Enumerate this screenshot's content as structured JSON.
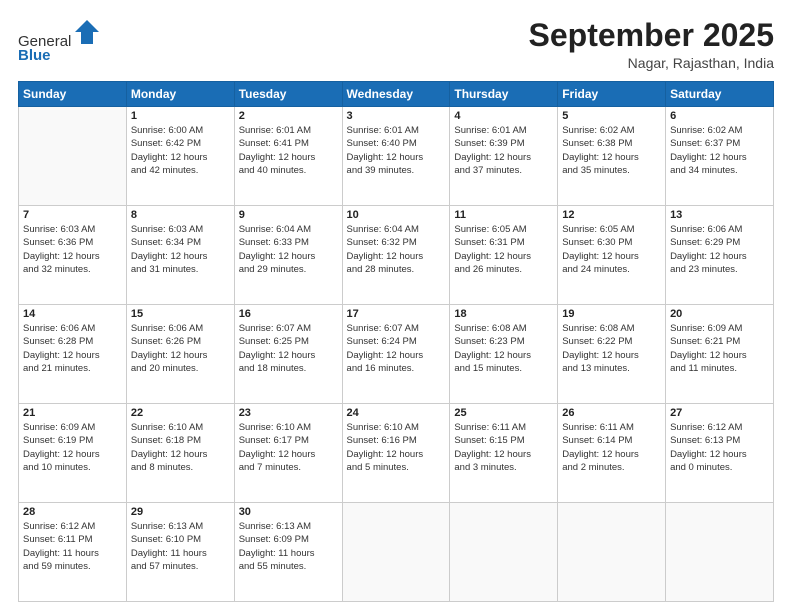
{
  "header": {
    "logo_line1": "General",
    "logo_line2": "Blue",
    "month": "September 2025",
    "location": "Nagar, Rajasthan, India"
  },
  "days_of_week": [
    "Sunday",
    "Monday",
    "Tuesday",
    "Wednesday",
    "Thursday",
    "Friday",
    "Saturday"
  ],
  "weeks": [
    [
      {
        "day": "",
        "info": ""
      },
      {
        "day": "1",
        "info": "Sunrise: 6:00 AM\nSunset: 6:42 PM\nDaylight: 12 hours\nand 42 minutes."
      },
      {
        "day": "2",
        "info": "Sunrise: 6:01 AM\nSunset: 6:41 PM\nDaylight: 12 hours\nand 40 minutes."
      },
      {
        "day": "3",
        "info": "Sunrise: 6:01 AM\nSunset: 6:40 PM\nDaylight: 12 hours\nand 39 minutes."
      },
      {
        "day": "4",
        "info": "Sunrise: 6:01 AM\nSunset: 6:39 PM\nDaylight: 12 hours\nand 37 minutes."
      },
      {
        "day": "5",
        "info": "Sunrise: 6:02 AM\nSunset: 6:38 PM\nDaylight: 12 hours\nand 35 minutes."
      },
      {
        "day": "6",
        "info": "Sunrise: 6:02 AM\nSunset: 6:37 PM\nDaylight: 12 hours\nand 34 minutes."
      }
    ],
    [
      {
        "day": "7",
        "info": "Sunrise: 6:03 AM\nSunset: 6:36 PM\nDaylight: 12 hours\nand 32 minutes."
      },
      {
        "day": "8",
        "info": "Sunrise: 6:03 AM\nSunset: 6:34 PM\nDaylight: 12 hours\nand 31 minutes."
      },
      {
        "day": "9",
        "info": "Sunrise: 6:04 AM\nSunset: 6:33 PM\nDaylight: 12 hours\nand 29 minutes."
      },
      {
        "day": "10",
        "info": "Sunrise: 6:04 AM\nSunset: 6:32 PM\nDaylight: 12 hours\nand 28 minutes."
      },
      {
        "day": "11",
        "info": "Sunrise: 6:05 AM\nSunset: 6:31 PM\nDaylight: 12 hours\nand 26 minutes."
      },
      {
        "day": "12",
        "info": "Sunrise: 6:05 AM\nSunset: 6:30 PM\nDaylight: 12 hours\nand 24 minutes."
      },
      {
        "day": "13",
        "info": "Sunrise: 6:06 AM\nSunset: 6:29 PM\nDaylight: 12 hours\nand 23 minutes."
      }
    ],
    [
      {
        "day": "14",
        "info": "Sunrise: 6:06 AM\nSunset: 6:28 PM\nDaylight: 12 hours\nand 21 minutes."
      },
      {
        "day": "15",
        "info": "Sunrise: 6:06 AM\nSunset: 6:26 PM\nDaylight: 12 hours\nand 20 minutes."
      },
      {
        "day": "16",
        "info": "Sunrise: 6:07 AM\nSunset: 6:25 PM\nDaylight: 12 hours\nand 18 minutes."
      },
      {
        "day": "17",
        "info": "Sunrise: 6:07 AM\nSunset: 6:24 PM\nDaylight: 12 hours\nand 16 minutes."
      },
      {
        "day": "18",
        "info": "Sunrise: 6:08 AM\nSunset: 6:23 PM\nDaylight: 12 hours\nand 15 minutes."
      },
      {
        "day": "19",
        "info": "Sunrise: 6:08 AM\nSunset: 6:22 PM\nDaylight: 12 hours\nand 13 minutes."
      },
      {
        "day": "20",
        "info": "Sunrise: 6:09 AM\nSunset: 6:21 PM\nDaylight: 12 hours\nand 11 minutes."
      }
    ],
    [
      {
        "day": "21",
        "info": "Sunrise: 6:09 AM\nSunset: 6:19 PM\nDaylight: 12 hours\nand 10 minutes."
      },
      {
        "day": "22",
        "info": "Sunrise: 6:10 AM\nSunset: 6:18 PM\nDaylight: 12 hours\nand 8 minutes."
      },
      {
        "day": "23",
        "info": "Sunrise: 6:10 AM\nSunset: 6:17 PM\nDaylight: 12 hours\nand 7 minutes."
      },
      {
        "day": "24",
        "info": "Sunrise: 6:10 AM\nSunset: 6:16 PM\nDaylight: 12 hours\nand 5 minutes."
      },
      {
        "day": "25",
        "info": "Sunrise: 6:11 AM\nSunset: 6:15 PM\nDaylight: 12 hours\nand 3 minutes."
      },
      {
        "day": "26",
        "info": "Sunrise: 6:11 AM\nSunset: 6:14 PM\nDaylight: 12 hours\nand 2 minutes."
      },
      {
        "day": "27",
        "info": "Sunrise: 6:12 AM\nSunset: 6:13 PM\nDaylight: 12 hours\nand 0 minutes."
      }
    ],
    [
      {
        "day": "28",
        "info": "Sunrise: 6:12 AM\nSunset: 6:11 PM\nDaylight: 11 hours\nand 59 minutes."
      },
      {
        "day": "29",
        "info": "Sunrise: 6:13 AM\nSunset: 6:10 PM\nDaylight: 11 hours\nand 57 minutes."
      },
      {
        "day": "30",
        "info": "Sunrise: 6:13 AM\nSunset: 6:09 PM\nDaylight: 11 hours\nand 55 minutes."
      },
      {
        "day": "",
        "info": ""
      },
      {
        "day": "",
        "info": ""
      },
      {
        "day": "",
        "info": ""
      },
      {
        "day": "",
        "info": ""
      }
    ]
  ]
}
